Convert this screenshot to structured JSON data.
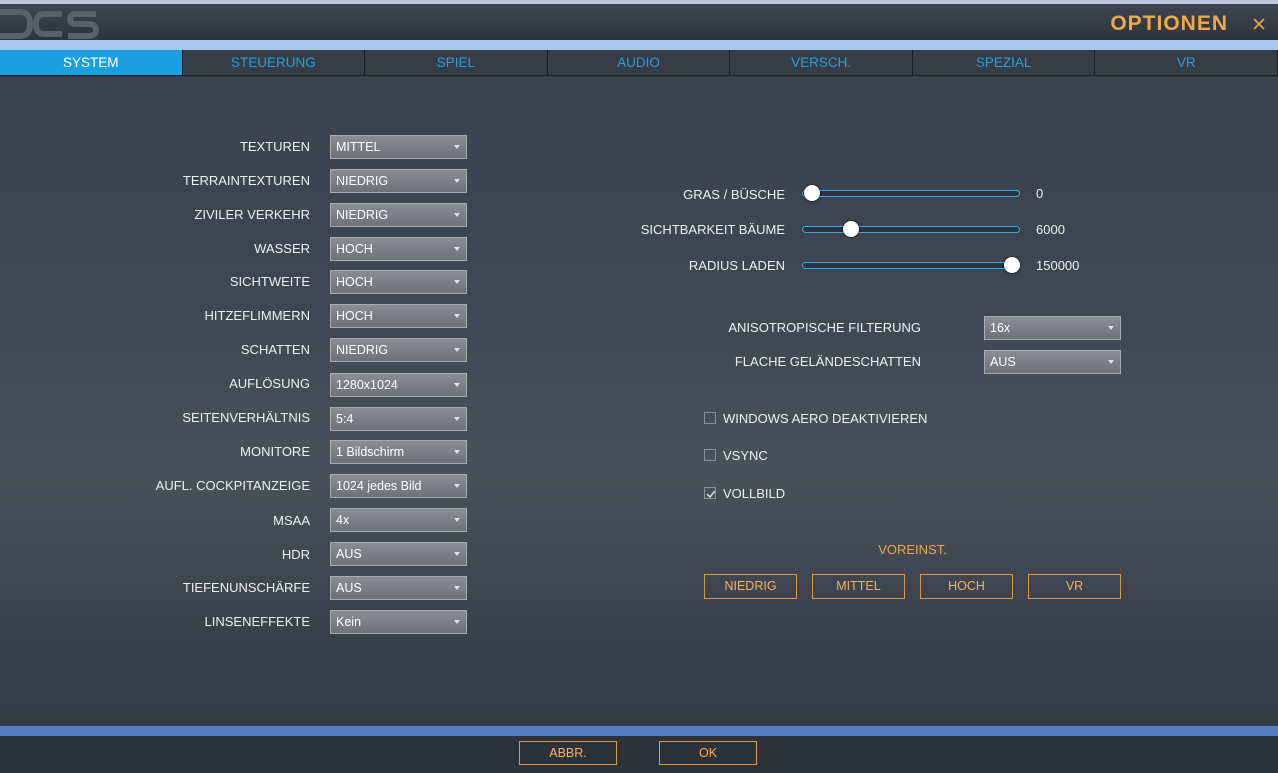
{
  "window": {
    "title": "OPTIONEN",
    "logo_text": "DCS"
  },
  "tabs": [
    {
      "label": "SYSTEM",
      "active": true
    },
    {
      "label": "STEUERUNG",
      "active": false
    },
    {
      "label": "SPIEL",
      "active": false
    },
    {
      "label": "AUDIO",
      "active": false
    },
    {
      "label": "VERSCH.",
      "active": false
    },
    {
      "label": "SPEZIAL",
      "active": false
    },
    {
      "label": "VR",
      "active": false
    }
  ],
  "left_settings": [
    {
      "label": "TEXTUREN",
      "value": "MITTEL"
    },
    {
      "label": "TERRAINTEXTUREN",
      "value": "NIEDRIG"
    },
    {
      "label": "ZIVILER VERKEHR",
      "value": "NIEDRIG"
    },
    {
      "label": "WASSER",
      "value": "HOCH"
    },
    {
      "label": "SICHTWEITE",
      "value": "HOCH"
    },
    {
      "label": "HITZEFLIMMERN",
      "value": "HOCH"
    },
    {
      "label": "SCHATTEN",
      "value": "NIEDRIG"
    },
    {
      "label": "AUFLÖSUNG",
      "value": "1280x1024"
    },
    {
      "label": "SEITENVERHÄLTNIS",
      "value": "5:4"
    },
    {
      "label": "MONITORE",
      "value": "1 Bildschirm"
    },
    {
      "label": "AUFL. COCKPITANZEIGE",
      "value": "1024 jedes Bild"
    },
    {
      "label": "MSAA",
      "value": "4x"
    },
    {
      "label": "HDR",
      "value": "AUS"
    },
    {
      "label": "TIEFENUNSCHÄRFE",
      "value": "AUS"
    },
    {
      "label": "LINSENEFFEKTE",
      "value": "Kein"
    }
  ],
  "sliders": [
    {
      "label": "GRAS / BÜSCHE",
      "value": "0",
      "fraction": 0.04
    },
    {
      "label": "SICHTBARKEIT BÄUME",
      "value": "6000",
      "fraction": 0.22
    },
    {
      "label": "RADIUS LADEN",
      "value": "150000",
      "fraction": 0.96
    }
  ],
  "right_settings": [
    {
      "label": "ANISOTROPISCHE FILTERUNG",
      "value": "16x"
    },
    {
      "label": "FLACHE GELÄNDESCHATTEN",
      "value": "AUS"
    }
  ],
  "checkboxes": [
    {
      "label": "WINDOWS AERO DEAKTIVIEREN",
      "checked": false
    },
    {
      "label": "VSYNC",
      "checked": false
    },
    {
      "label": "VOLLBILD",
      "checked": true
    }
  ],
  "presets": {
    "title": "VOREINST.",
    "buttons": [
      "NIEDRIG",
      "MITTEL",
      "HOCH",
      "VR"
    ]
  },
  "footer": {
    "cancel_label": "ABBR.",
    "ok_label": "OK"
  },
  "colors": {
    "accent_orange": "#f0a848",
    "tab_blue": "#1a9fe0",
    "tab_text": "#2a9fd8"
  }
}
